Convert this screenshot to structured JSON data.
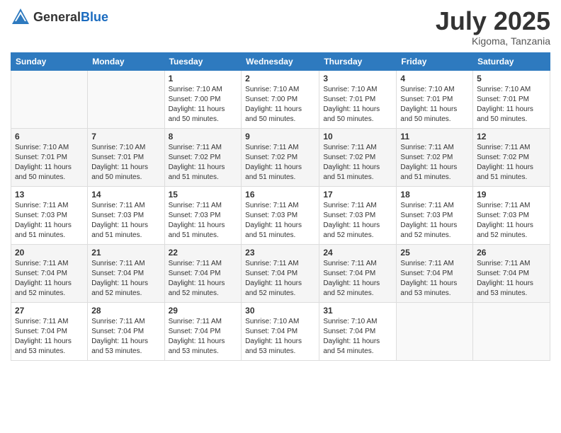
{
  "header": {
    "logo": {
      "general": "General",
      "blue": "Blue"
    },
    "title": "July 2025",
    "location": "Kigoma, Tanzania"
  },
  "calendar": {
    "days_of_week": [
      "Sunday",
      "Monday",
      "Tuesday",
      "Wednesday",
      "Thursday",
      "Friday",
      "Saturday"
    ],
    "weeks": [
      [
        {
          "day": "",
          "info": ""
        },
        {
          "day": "",
          "info": ""
        },
        {
          "day": "1",
          "info": "Sunrise: 7:10 AM\nSunset: 7:00 PM\nDaylight: 11 hours and 50 minutes."
        },
        {
          "day": "2",
          "info": "Sunrise: 7:10 AM\nSunset: 7:00 PM\nDaylight: 11 hours and 50 minutes."
        },
        {
          "day": "3",
          "info": "Sunrise: 7:10 AM\nSunset: 7:01 PM\nDaylight: 11 hours and 50 minutes."
        },
        {
          "day": "4",
          "info": "Sunrise: 7:10 AM\nSunset: 7:01 PM\nDaylight: 11 hours and 50 minutes."
        },
        {
          "day": "5",
          "info": "Sunrise: 7:10 AM\nSunset: 7:01 PM\nDaylight: 11 hours and 50 minutes."
        }
      ],
      [
        {
          "day": "6",
          "info": "Sunrise: 7:10 AM\nSunset: 7:01 PM\nDaylight: 11 hours and 50 minutes."
        },
        {
          "day": "7",
          "info": "Sunrise: 7:10 AM\nSunset: 7:01 PM\nDaylight: 11 hours and 50 minutes."
        },
        {
          "day": "8",
          "info": "Sunrise: 7:11 AM\nSunset: 7:02 PM\nDaylight: 11 hours and 51 minutes."
        },
        {
          "day": "9",
          "info": "Sunrise: 7:11 AM\nSunset: 7:02 PM\nDaylight: 11 hours and 51 minutes."
        },
        {
          "day": "10",
          "info": "Sunrise: 7:11 AM\nSunset: 7:02 PM\nDaylight: 11 hours and 51 minutes."
        },
        {
          "day": "11",
          "info": "Sunrise: 7:11 AM\nSunset: 7:02 PM\nDaylight: 11 hours and 51 minutes."
        },
        {
          "day": "12",
          "info": "Sunrise: 7:11 AM\nSunset: 7:02 PM\nDaylight: 11 hours and 51 minutes."
        }
      ],
      [
        {
          "day": "13",
          "info": "Sunrise: 7:11 AM\nSunset: 7:03 PM\nDaylight: 11 hours and 51 minutes."
        },
        {
          "day": "14",
          "info": "Sunrise: 7:11 AM\nSunset: 7:03 PM\nDaylight: 11 hours and 51 minutes."
        },
        {
          "day": "15",
          "info": "Sunrise: 7:11 AM\nSunset: 7:03 PM\nDaylight: 11 hours and 51 minutes."
        },
        {
          "day": "16",
          "info": "Sunrise: 7:11 AM\nSunset: 7:03 PM\nDaylight: 11 hours and 51 minutes."
        },
        {
          "day": "17",
          "info": "Sunrise: 7:11 AM\nSunset: 7:03 PM\nDaylight: 11 hours and 52 minutes."
        },
        {
          "day": "18",
          "info": "Sunrise: 7:11 AM\nSunset: 7:03 PM\nDaylight: 11 hours and 52 minutes."
        },
        {
          "day": "19",
          "info": "Sunrise: 7:11 AM\nSunset: 7:03 PM\nDaylight: 11 hours and 52 minutes."
        }
      ],
      [
        {
          "day": "20",
          "info": "Sunrise: 7:11 AM\nSunset: 7:04 PM\nDaylight: 11 hours and 52 minutes."
        },
        {
          "day": "21",
          "info": "Sunrise: 7:11 AM\nSunset: 7:04 PM\nDaylight: 11 hours and 52 minutes."
        },
        {
          "day": "22",
          "info": "Sunrise: 7:11 AM\nSunset: 7:04 PM\nDaylight: 11 hours and 52 minutes."
        },
        {
          "day": "23",
          "info": "Sunrise: 7:11 AM\nSunset: 7:04 PM\nDaylight: 11 hours and 52 minutes."
        },
        {
          "day": "24",
          "info": "Sunrise: 7:11 AM\nSunset: 7:04 PM\nDaylight: 11 hours and 52 minutes."
        },
        {
          "day": "25",
          "info": "Sunrise: 7:11 AM\nSunset: 7:04 PM\nDaylight: 11 hours and 53 minutes."
        },
        {
          "day": "26",
          "info": "Sunrise: 7:11 AM\nSunset: 7:04 PM\nDaylight: 11 hours and 53 minutes."
        }
      ],
      [
        {
          "day": "27",
          "info": "Sunrise: 7:11 AM\nSunset: 7:04 PM\nDaylight: 11 hours and 53 minutes."
        },
        {
          "day": "28",
          "info": "Sunrise: 7:11 AM\nSunset: 7:04 PM\nDaylight: 11 hours and 53 minutes."
        },
        {
          "day": "29",
          "info": "Sunrise: 7:11 AM\nSunset: 7:04 PM\nDaylight: 11 hours and 53 minutes."
        },
        {
          "day": "30",
          "info": "Sunrise: 7:10 AM\nSunset: 7:04 PM\nDaylight: 11 hours and 53 minutes."
        },
        {
          "day": "31",
          "info": "Sunrise: 7:10 AM\nSunset: 7:04 PM\nDaylight: 11 hours and 54 minutes."
        },
        {
          "day": "",
          "info": ""
        },
        {
          "day": "",
          "info": ""
        }
      ]
    ]
  }
}
